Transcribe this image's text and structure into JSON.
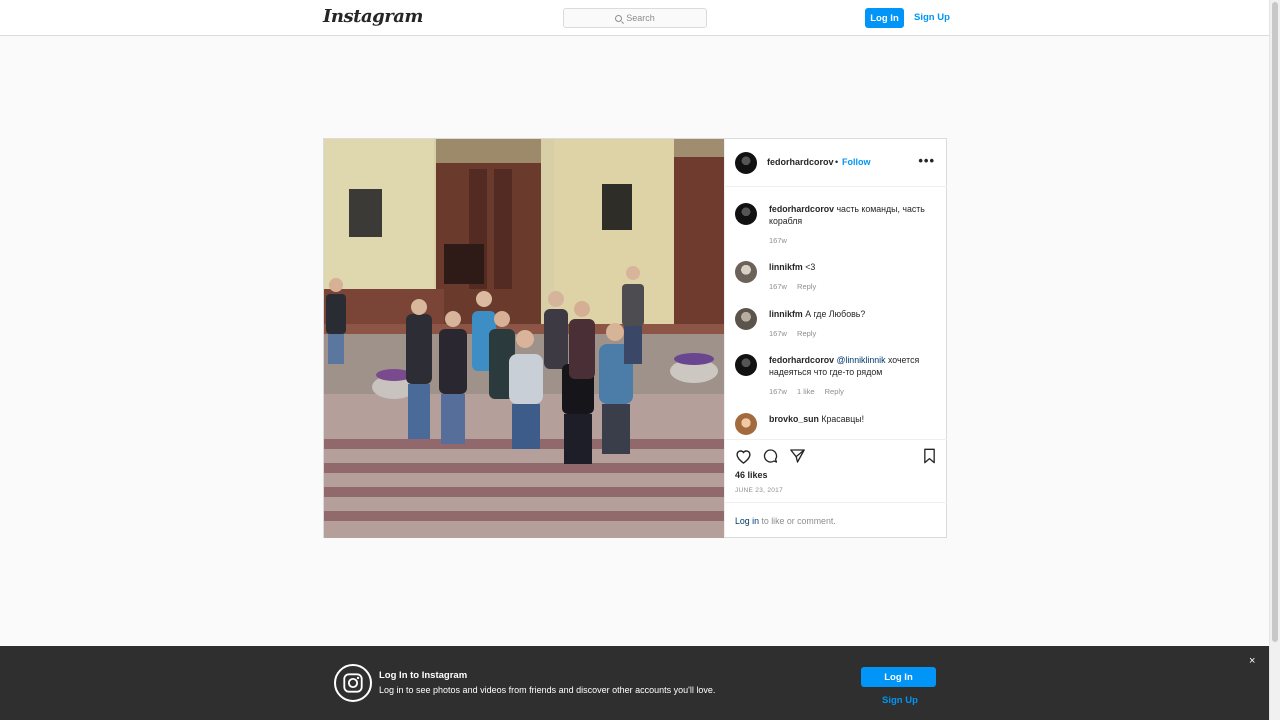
{
  "nav": {
    "logo": "Instagram",
    "search_placeholder": "Search",
    "login_label": "Log In",
    "signup_label": "Sign Up"
  },
  "post": {
    "username": "fedorhardcorov",
    "separator": "•",
    "follow_label": "Follow",
    "more_label": "•••",
    "comments": [
      {
        "user": "fedorhardcorov",
        "text": "часть команды, часть корабля ",
        "time": "167w"
      },
      {
        "user": "linnikfm",
        "text": "<3",
        "time": "167w",
        "reply": "Reply"
      },
      {
        "user": "linnikfm",
        "text": "А где Любовь?",
        "time": "167w",
        "reply": "Reply"
      },
      {
        "user": "fedorhardcorov",
        "mention": "@linniklinnik",
        "text": "хочется надеяться что где-то рядом",
        "time": "167w",
        "likes": "1 like",
        "reply": "Reply"
      },
      {
        "user": "brovko_sun",
        "text": "Красавцы!"
      }
    ],
    "likes": "46 likes",
    "date": "JUNE 23, 2017",
    "login_link": "Log in",
    "login_suffix": "to like or comment."
  },
  "banner": {
    "title": "Log In to Instagram",
    "subtitle": "Log in to see photos and videos from friends and discover other accounts you'll love.",
    "login_label": "Log In",
    "signup_label": "Sign Up",
    "close_label": "×"
  },
  "colors": {
    "accent": "#0095f6",
    "link_dark": "#00376b",
    "banner_bg": "#262626"
  }
}
